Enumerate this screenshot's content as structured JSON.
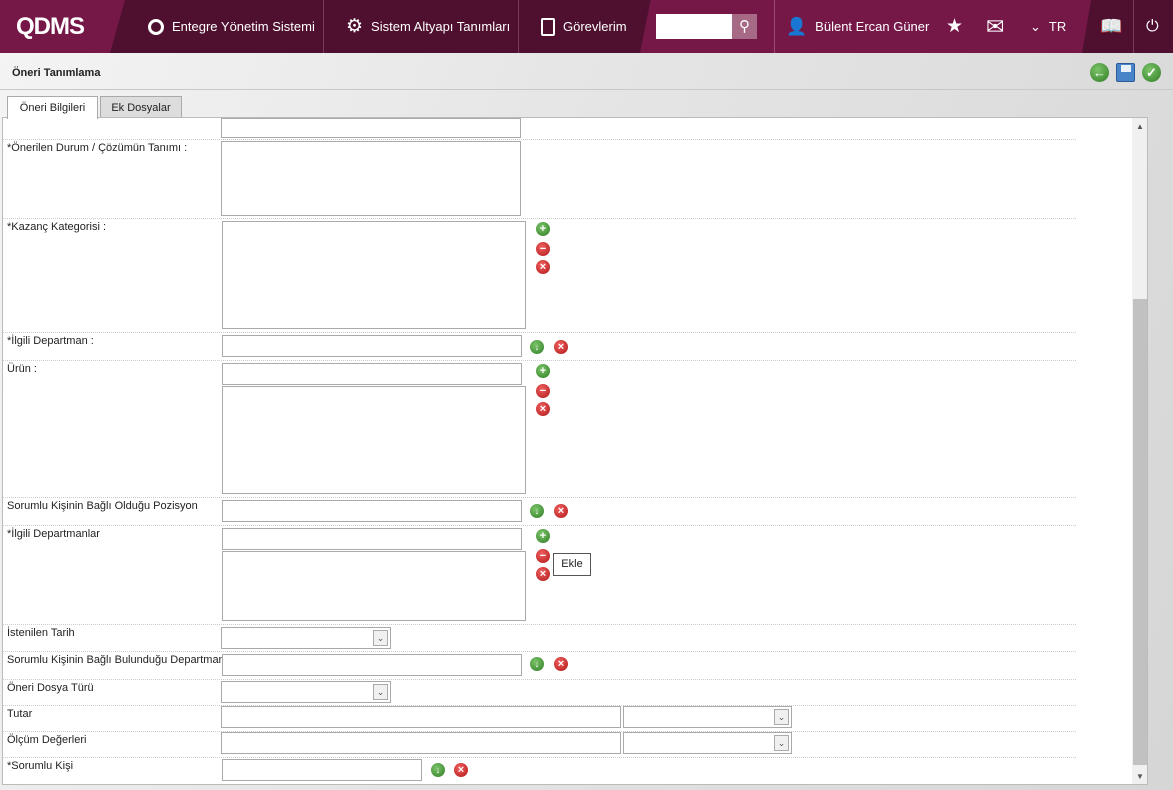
{
  "header": {
    "logo": "QDMS",
    "nav": [
      {
        "label": "Entegre Yönetim Sistemi"
      },
      {
        "label": "Sistem Altyapı Tanımları"
      },
      {
        "label": "Görevlerim"
      }
    ],
    "search_value": "",
    "user_name": "Bülent Ercan Güner",
    "language": "TR",
    "colors": {
      "dark": "#4f1030",
      "accent": "#751848"
    }
  },
  "page": {
    "title": "Öneri Tanımlama"
  },
  "tabs": [
    {
      "label": "Öneri Bilgileri",
      "active": true
    },
    {
      "label": "Ek Dosyalar",
      "active": false
    }
  ],
  "form": {
    "fields": {
      "onerilen_durum": "*Önerilen Durum / Çözümün Tanımı :",
      "kazanc": "*Kazanç Kategorisi :",
      "ilgili_departman": "*İlgili Departman :",
      "urun": "Ürün :",
      "sorumlu_pozisyon": "Sorumlu Kişinin Bağlı Olduğu Pozisyon",
      "ilgili_departmanlar": "*İlgili Departmanlar",
      "istenilen_tarih": "İstenilen Tarih",
      "sorumlu_departman": "Sorumlu Kişinin Bağlı Bulunduğu Departman",
      "dosya_turu": "Öneri Dosya Türü",
      "tutar": "Tutar",
      "olcum": "Ölçüm Değerleri",
      "sorumlu_kisi": "*Sorumlu Kişi"
    },
    "tooltip": "Ekle"
  }
}
